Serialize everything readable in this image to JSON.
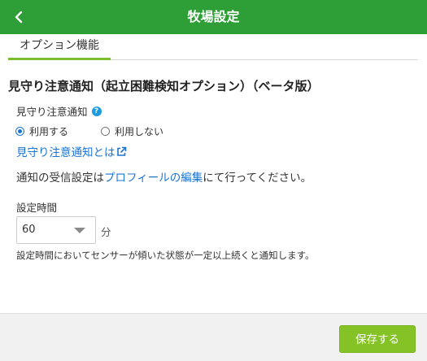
{
  "header": {
    "title": "牧場設定",
    "back_icon": "chevron-left-icon"
  },
  "tabs": [
    {
      "label": "オプション機能",
      "active": true
    }
  ],
  "section": {
    "title": "見守り注意通知（起立困難検知オプション）（ベータ版）",
    "field_label": "見守り注意通知",
    "help_icon": "question-circle-icon",
    "radio_options": [
      {
        "label": "利用する",
        "checked": true
      },
      {
        "label": "利用しない",
        "checked": false
      }
    ],
    "about_link": "見守り注意通知とは",
    "about_link_icon": "external-link-icon",
    "notice_prefix": "通知の受信設定は",
    "notice_link": "プロフィールの編集",
    "notice_suffix": "にて行ってください。"
  },
  "time_setting": {
    "label": "設定時間",
    "selected_value": "60",
    "unit": "分",
    "description": "設定時間においてセンサーが傾いた状態が一定以上続くと通知します。"
  },
  "footer": {
    "save_label": "保存する"
  },
  "colors": {
    "header_bg": "#2e9e36",
    "tab_underline": "#7cbf2e",
    "link": "#1b74d2",
    "help_icon": "#1b9be0",
    "save_button": "#85c226",
    "footer_bg": "#f1f1f1"
  }
}
